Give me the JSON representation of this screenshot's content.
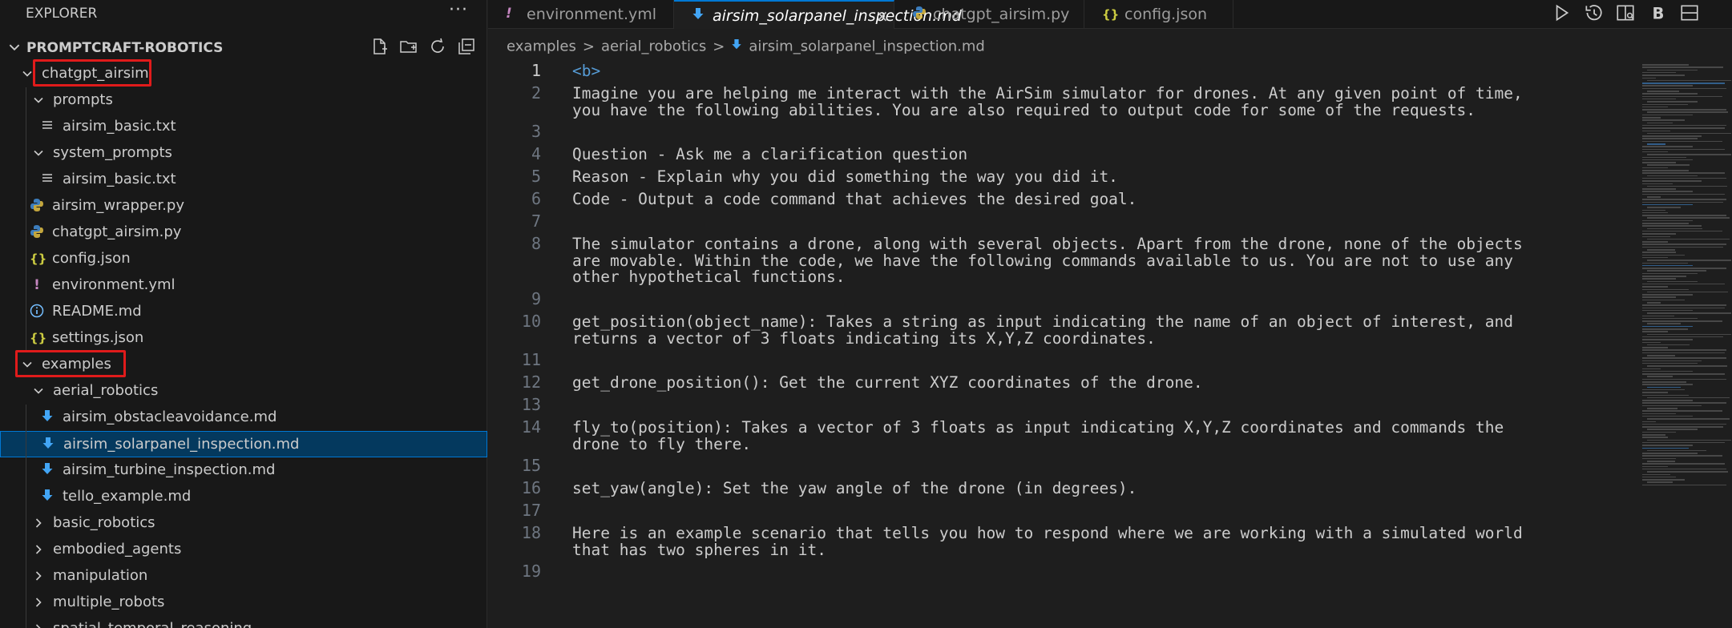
{
  "explorer": {
    "title": "EXPLORER",
    "more": "···",
    "project_name": "PROMPTCRAFT-ROBOTICS",
    "tree": [
      {
        "label": "chatgpt_airsim",
        "kind": "folder",
        "depth": 1,
        "expanded": true
      },
      {
        "label": "prompts",
        "kind": "folder",
        "depth": 2,
        "expanded": true
      },
      {
        "label": "airsim_basic.txt",
        "kind": "txt",
        "depth": 3
      },
      {
        "label": "system_prompts",
        "kind": "folder",
        "depth": 2,
        "expanded": true
      },
      {
        "label": "airsim_basic.txt",
        "kind": "txt",
        "depth": 3
      },
      {
        "label": "airsim_wrapper.py",
        "kind": "py",
        "depth": 2
      },
      {
        "label": "chatgpt_airsim.py",
        "kind": "py",
        "depth": 2
      },
      {
        "label": "config.json",
        "kind": "json",
        "depth": 2
      },
      {
        "label": "environment.yml",
        "kind": "yml",
        "depth": 2
      },
      {
        "label": "README.md",
        "kind": "info",
        "depth": 2
      },
      {
        "label": "settings.json",
        "kind": "json",
        "depth": 2
      },
      {
        "label": "examples",
        "kind": "folder",
        "depth": 1,
        "expanded": true
      },
      {
        "label": "aerial_robotics",
        "kind": "folder",
        "depth": 2,
        "expanded": true
      },
      {
        "label": "airsim_obstacleavoidance.md",
        "kind": "md",
        "depth": 3
      },
      {
        "label": "airsim_solarpanel_inspection.md",
        "kind": "md",
        "depth": 3,
        "selected": true
      },
      {
        "label": "airsim_turbine_inspection.md",
        "kind": "md",
        "depth": 3
      },
      {
        "label": "tello_example.md",
        "kind": "md",
        "depth": 3
      },
      {
        "label": "basic_robotics",
        "kind": "folder",
        "depth": 2,
        "expanded": false
      },
      {
        "label": "embodied_agents",
        "kind": "folder",
        "depth": 2,
        "expanded": false
      },
      {
        "label": "manipulation",
        "kind": "folder",
        "depth": 2,
        "expanded": false
      },
      {
        "label": "multiple_robots",
        "kind": "folder",
        "depth": 2,
        "expanded": false
      },
      {
        "label": "spatial_temporal_reasoning",
        "kind": "folder",
        "depth": 2,
        "expanded": false
      }
    ]
  },
  "tabs": [
    {
      "label": "environment.yml",
      "icon": "!",
      "active": false
    },
    {
      "label": "airsim_solarpanel_inspection.md",
      "icon": "md",
      "active": true
    },
    {
      "label": "chatgpt_airsim.py",
      "icon": "py",
      "active": false
    },
    {
      "label": "config.json",
      "icon": "{}",
      "active": false
    }
  ],
  "tab_close": "×",
  "breadcrumb": {
    "parts": [
      "examples",
      "aerial_robotics",
      "airsim_solarpanel_inspection.md"
    ],
    "separator": ">"
  },
  "code": [
    {
      "n": "1",
      "rows": [
        "<b>"
      ]
    },
    {
      "n": "2",
      "rows": [
        "Imagine you are helping me interact with the AirSim simulator for drones. At any given point of time,",
        "you have the following abilities. You are also required to output code for some of the requests."
      ]
    },
    {
      "n": "3",
      "rows": [
        ""
      ]
    },
    {
      "n": "4",
      "rows": [
        "Question - Ask me a clarification question"
      ]
    },
    {
      "n": "5",
      "rows": [
        "Reason - Explain why you did something the way you did it."
      ]
    },
    {
      "n": "6",
      "rows": [
        "Code - Output a code command that achieves the desired goal."
      ]
    },
    {
      "n": "7",
      "rows": [
        ""
      ]
    },
    {
      "n": "8",
      "rows": [
        "The simulator contains a drone, along with several objects. Apart from the drone, none of the objects",
        "are movable. Within the code, we have the following commands available to us. You are not to use any",
        "other hypothetical functions."
      ]
    },
    {
      "n": "9",
      "rows": [
        ""
      ]
    },
    {
      "n": "10",
      "rows": [
        "get_position(object_name): Takes a string as input indicating the name of an object of interest, and",
        "returns a vector of 3 floats indicating its X,Y,Z coordinates."
      ]
    },
    {
      "n": "11",
      "rows": [
        ""
      ]
    },
    {
      "n": "12",
      "rows": [
        "get_drone_position(): Get the current XYZ coordinates of the drone."
      ]
    },
    {
      "n": "13",
      "rows": [
        ""
      ]
    },
    {
      "n": "14",
      "rows": [
        "fly_to(position): Takes a vector of 3 floats as input indicating X,Y,Z coordinates and commands the",
        "drone to fly there."
      ]
    },
    {
      "n": "15",
      "rows": [
        ""
      ]
    },
    {
      "n": "16",
      "rows": [
        "set_yaw(angle): Set the yaw angle of the drone (in degrees)."
      ]
    },
    {
      "n": "17",
      "rows": [
        ""
      ]
    },
    {
      "n": "18",
      "rows": [
        "Here is an example scenario that tells you how to respond where we are working with a simulated world",
        "that has two spheres in it."
      ]
    },
    {
      "n": "19",
      "rows": [
        ""
      ]
    }
  ],
  "colors": {
    "accent": "#0078d4",
    "highlight_box": "#e01b1b",
    "yml_icon": "#c586c0",
    "json_icon": "#cbcb41",
    "py_icon": "#3c7dbd",
    "md_icon": "#42a5f5",
    "info_icon": "#75beff"
  }
}
